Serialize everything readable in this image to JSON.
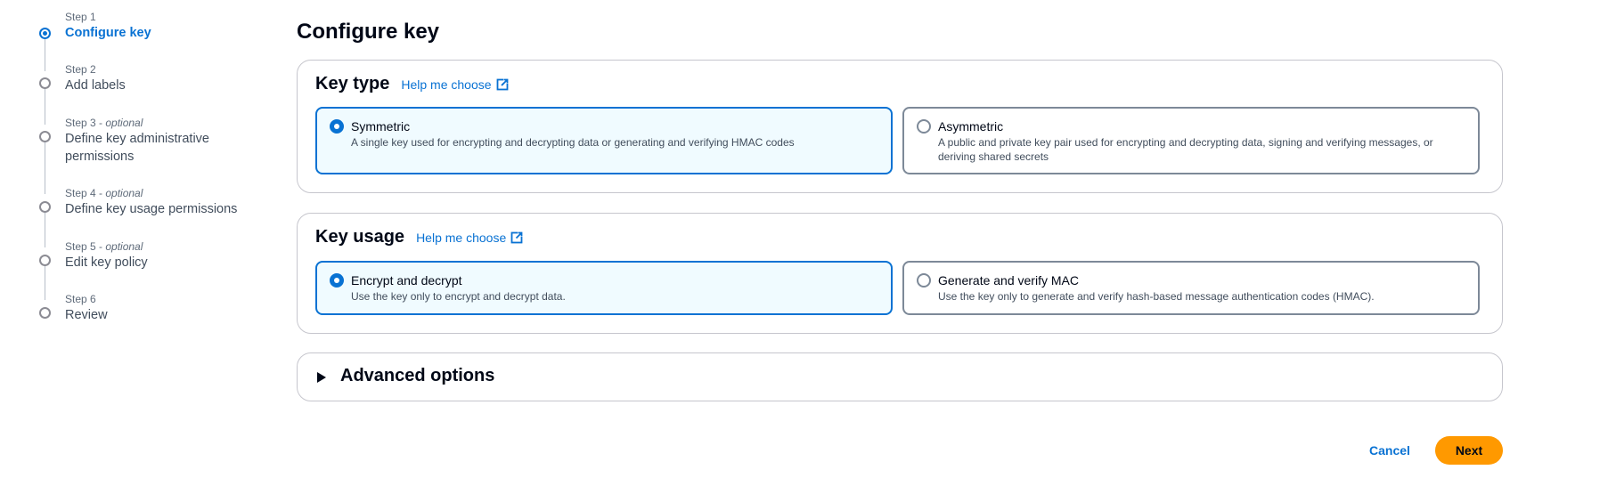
{
  "steps": [
    {
      "meta": "Step 1",
      "optional": "",
      "title": "Configure key",
      "active": true
    },
    {
      "meta": "Step 2",
      "optional": "",
      "title": "Add labels",
      "active": false
    },
    {
      "meta": "Step 3 - ",
      "optional": "optional",
      "title": "Define key administrative permissions",
      "active": false
    },
    {
      "meta": "Step 4 - ",
      "optional": "optional",
      "title": "Define key usage permissions",
      "active": false
    },
    {
      "meta": "Step 5 - ",
      "optional": "optional",
      "title": "Edit key policy",
      "active": false
    },
    {
      "meta": "Step 6",
      "optional": "",
      "title": "Review",
      "active": false
    }
  ],
  "page": {
    "title": "Configure key"
  },
  "key_type": {
    "title": "Key type",
    "help": "Help me choose",
    "options": [
      {
        "label": "Symmetric",
        "description": "A single key used for encrypting and decrypting data or generating and verifying HMAC codes",
        "selected": true
      },
      {
        "label": "Asymmetric",
        "description": "A public and private key pair used for encrypting and decrypting data, signing and verifying messages, or deriving shared secrets",
        "selected": false
      }
    ]
  },
  "key_usage": {
    "title": "Key usage",
    "help": "Help me choose",
    "options": [
      {
        "label": "Encrypt and decrypt",
        "description": "Use the key only to encrypt and decrypt data.",
        "selected": true
      },
      {
        "label": "Generate and verify MAC",
        "description": "Use the key only to generate and verify hash-based message authentication codes (HMAC).",
        "selected": false
      }
    ]
  },
  "advanced": {
    "title": "Advanced options",
    "expanded": false
  },
  "footer": {
    "cancel": "Cancel",
    "next": "Next"
  },
  "colors": {
    "accent": "#0972d3",
    "primary_button": "#ff9900",
    "selected_tile_bg": "#f0fbff"
  },
  "icons": {
    "help_link": "external-link-icon",
    "advanced_toggle": "caret-right-icon"
  }
}
